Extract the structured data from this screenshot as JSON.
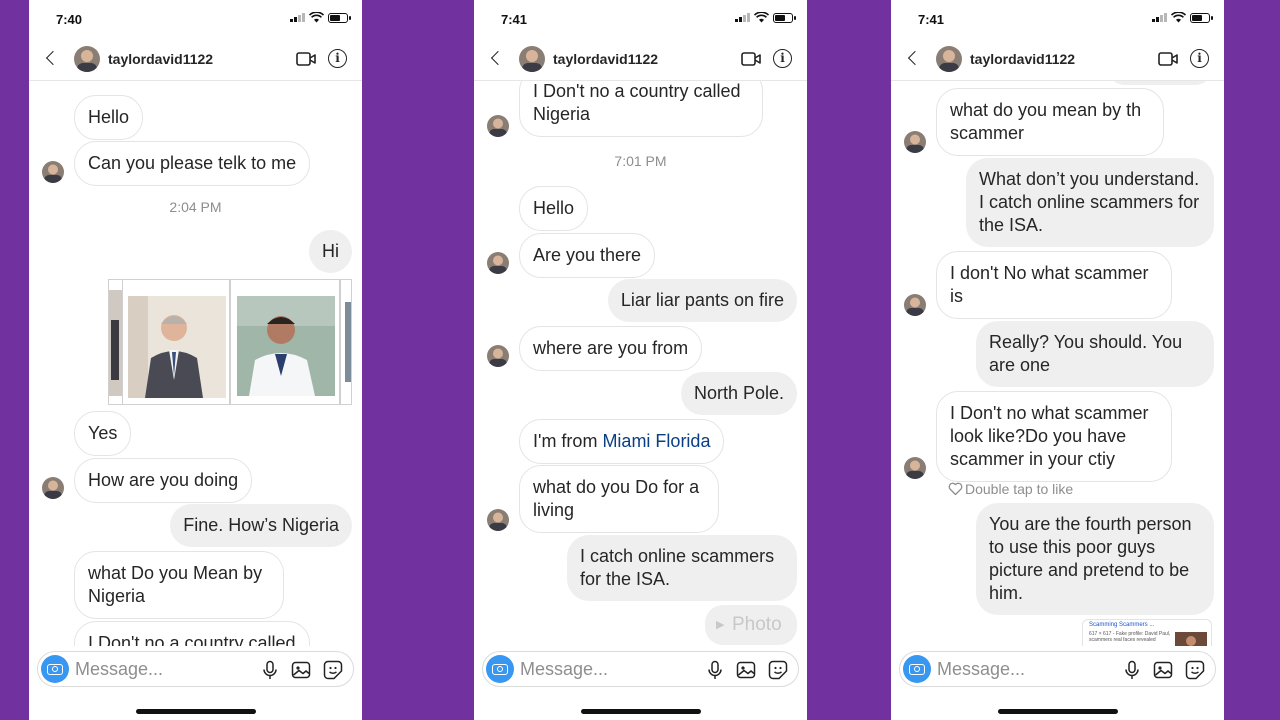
{
  "app": {
    "username": "taylordavid1122",
    "message_placeholder": "Message..."
  },
  "colors": {
    "background": "#7132a0",
    "outgoing_bubble": "#efefef",
    "incoming_border": "#e4e4e4",
    "camera_button": "#3897f0",
    "link": "#0b3f83"
  },
  "icons": [
    "back-chevron-icon",
    "video-call-icon",
    "info-icon",
    "camera-icon",
    "microphone-icon",
    "gallery-icon",
    "sticker-icon",
    "heart-icon",
    "signal-icon",
    "wifi-icon",
    "battery-icon"
  ],
  "panels": [
    {
      "time": "7:40",
      "messages": {
        "m1": "Hello",
        "m2": "Can you please telk to me",
        "ts1": "2:04 PM",
        "m3": "Hi",
        "m4": "Yes",
        "m5": "How are you doing",
        "m6": "Fine.  How’s Nigeria",
        "m7": "what Do you Mean by Nigeria",
        "m8": "I Don't no a country called"
      }
    },
    {
      "time": "7:41",
      "messages": {
        "m1": "I Don't no a country called Nigeria",
        "ts1": "7:01 PM",
        "m2": "Hello",
        "m3": "Are you there",
        "m4": "Liar liar pants on fire",
        "m5": "where are you from",
        "m6": "North Pole.",
        "m7a": "I'm from ",
        "m7b": "Miami Florida",
        "m8": "what do you Do for a living",
        "m9": "I catch online scammers for the ISA.",
        "m10": "Photo"
      }
    },
    {
      "time": "7:41",
      "messages": {
        "m1": "what do you mean by th scammer",
        "m2": "What don’t you understand.  I catch online scammers for the ISA.",
        "m3": "I don't No what scammer is",
        "m4": "Really?   You should.  You are one",
        "m5": "I Don't no what scammer look like?Do you have scammer in your ctiy",
        "dtl": "Double tap to like",
        "m6": "You are the fourth person to use this poor guys picture and pretend to be him.",
        "preview_title": "Scamming Scammers ...",
        "preview_sub": "617 × 617 - Fake profile: David Paul, scammers real faces revealed"
      }
    }
  ]
}
